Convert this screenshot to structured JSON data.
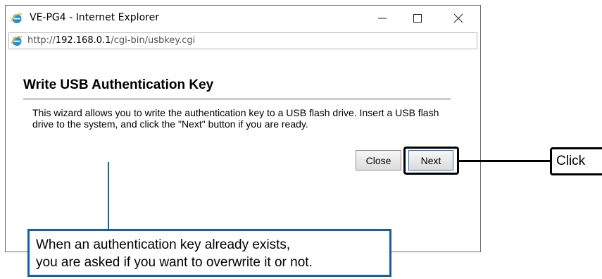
{
  "window": {
    "title": "VE-PG4 - Internet Explorer",
    "controls": [
      "minimize-icon",
      "maximize-icon",
      "close-icon"
    ]
  },
  "address_bar": {
    "prefix": "http://",
    "host": "192.168.0.1",
    "path": "/cgi-bin/usbkey.cgi"
  },
  "page": {
    "title": "Write USB Authentication Key",
    "description": "This wizard allows you to write the authentication key to a USB flash drive. Insert a USB flash drive to the system, and click the \"Next\" button if you are ready.",
    "close_label": "Close",
    "next_label": "Next"
  },
  "annotations": {
    "click_label": "Click",
    "note_line1": "When an authentication key already exists,",
    "note_line2": "you are asked if you want to overwrite it or not."
  },
  "colors": {
    "ie_blue": "#1e90d6",
    "ie_ring": "#f1c232",
    "callout_blue": "#0f62a6"
  }
}
